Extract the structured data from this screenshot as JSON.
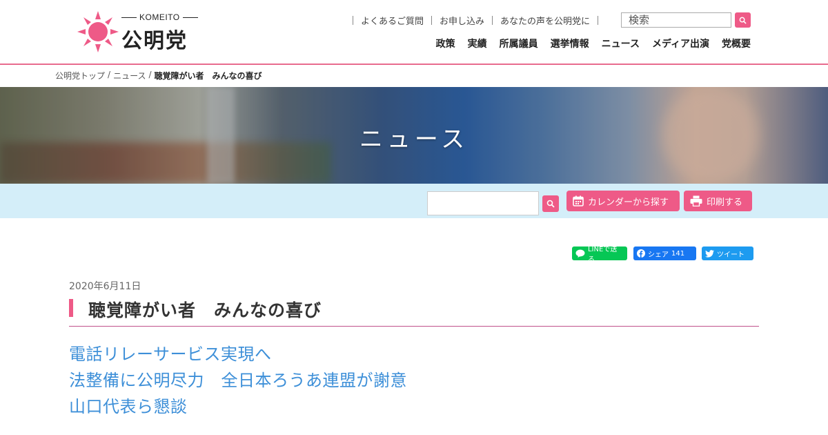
{
  "header": {
    "logo_en": "KOMEITO",
    "logo_jp": "公明党",
    "util_links": [
      "よくあるご質問",
      "お申し込み",
      "あなたの声を公明党に"
    ],
    "search_placeholder": "検索",
    "main_nav": [
      "政策",
      "実績",
      "所属議員",
      "選挙情報",
      "ニュース",
      "メディア出演",
      "党概要"
    ]
  },
  "breadcrumb": {
    "items": [
      "公明党トップ",
      "ニュース"
    ],
    "separator": "/",
    "current": "聴覚障がい者　みんなの喜び"
  },
  "hero": {
    "title": "ニュース"
  },
  "toolbar": {
    "calendar_label": "カレンダーから探す",
    "print_label": "印刷する"
  },
  "social": {
    "line_label": "LINEで送る",
    "fb_label": "シェア",
    "fb_count": "141",
    "tw_label": "ツイート"
  },
  "article": {
    "date": "2020年6月11日",
    "title": "聴覚障がい者　みんなの喜び",
    "subheads": [
      "電話リレーサービス実現へ",
      "法整備に公明尽力　全日本ろうあ連盟が謝意",
      "山口代表ら懇談"
    ]
  },
  "colors": {
    "accent_pink": "#ee5a87",
    "link_blue": "#3d8fd8",
    "toolbar_bg": "#d4eef9",
    "line_green": "#06c755",
    "facebook_blue": "#1877f2",
    "twitter_blue": "#1d9bf0"
  }
}
